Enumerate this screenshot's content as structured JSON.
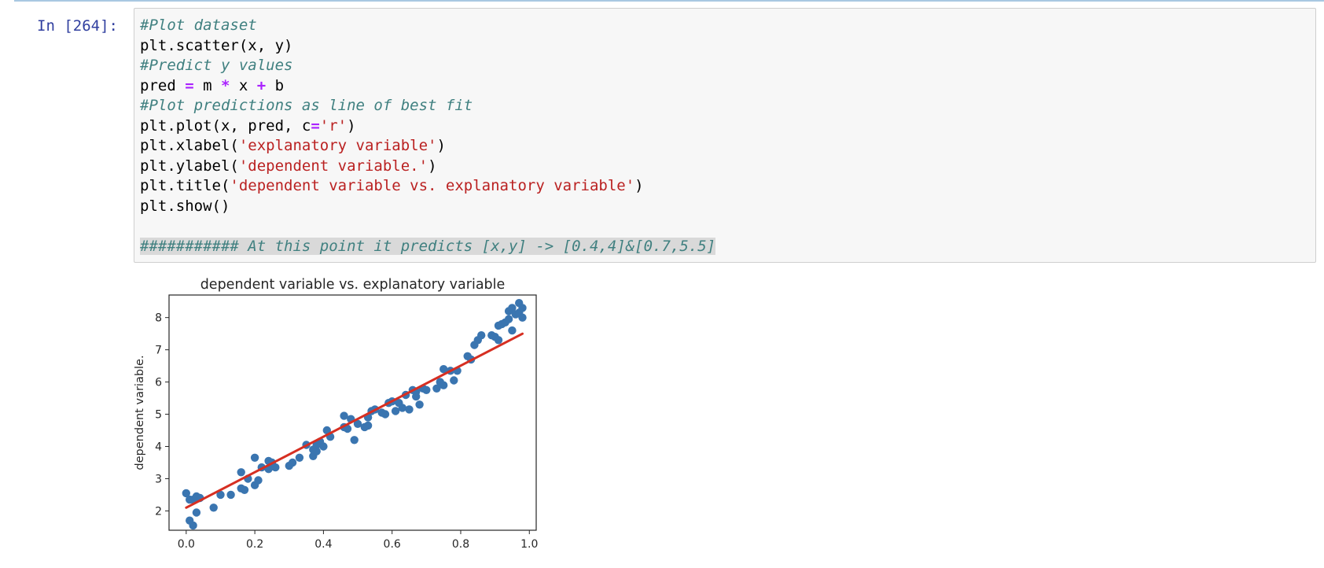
{
  "cell": {
    "prompt": "In [264]:",
    "code_lines": [
      [
        {
          "t": "#Plot dataset",
          "k": "comment"
        }
      ],
      [
        {
          "t": "plt.scatter(x, y)",
          "k": ""
        }
      ],
      [
        {
          "t": "#Predict y values",
          "k": "comment"
        }
      ],
      [
        {
          "t": "pred ",
          "k": ""
        },
        {
          "t": "=",
          "k": "op"
        },
        {
          "t": " m ",
          "k": ""
        },
        {
          "t": "*",
          "k": "op"
        },
        {
          "t": " x ",
          "k": ""
        },
        {
          "t": "+",
          "k": "op"
        },
        {
          "t": " b",
          "k": ""
        }
      ],
      [
        {
          "t": "#Plot predictions as line of best fit",
          "k": "comment"
        }
      ],
      [
        {
          "t": "plt.plot(x, pred, c",
          "k": ""
        },
        {
          "t": "=",
          "k": "op"
        },
        {
          "t": "'r'",
          "k": "str"
        },
        {
          "t": ")",
          "k": ""
        }
      ],
      [
        {
          "t": "plt.xlabel(",
          "k": ""
        },
        {
          "t": "'explanatory variable'",
          "k": "str"
        },
        {
          "t": ")",
          "k": ""
        }
      ],
      [
        {
          "t": "plt.ylabel(",
          "k": ""
        },
        {
          "t": "'dependent variable.'",
          "k": "str"
        },
        {
          "t": ")",
          "k": ""
        }
      ],
      [
        {
          "t": "plt.title(",
          "k": ""
        },
        {
          "t": "'dependent variable vs. explanatory variable'",
          "k": "str"
        },
        {
          "t": ")",
          "k": ""
        }
      ],
      [
        {
          "t": "plt.show()",
          "k": ""
        }
      ],
      [],
      [
        {
          "t": "########### At this point it predicts [x,y] -> [0.4,4]&[0.7,5.5]",
          "k": "comment hl"
        }
      ]
    ]
  },
  "colors": {
    "points": "#3a75b0",
    "line": "#d62f22",
    "prompt": "#303f9f",
    "comment": "#408080",
    "string": "#ba2121",
    "operator": "#aa22ff"
  },
  "chart_data": {
    "type": "scatter",
    "title": "dependent variable vs. explanatory variable",
    "xlabel": "",
    "ylabel": "dependent variable.",
    "xlim": [
      -0.05,
      1.02
    ],
    "ylim": [
      1.4,
      8.7
    ],
    "xticks": [
      0.0,
      0.2,
      0.4,
      0.6,
      0.8,
      1.0
    ],
    "xtick_labels": [
      "0.0",
      "0.2",
      "0.4",
      "0.6",
      "0.8",
      "1.0"
    ],
    "yticks": [
      2,
      3,
      4,
      5,
      6,
      7,
      8
    ],
    "ytick_labels": [
      "2",
      "3",
      "4",
      "5",
      "6",
      "7",
      "8"
    ],
    "grid": false,
    "series": [
      {
        "kind": "points",
        "x": [
          0.0,
          0.01,
          0.02,
          0.03,
          0.04,
          0.01,
          0.02,
          0.03,
          0.08,
          0.1,
          0.13,
          0.16,
          0.16,
          0.17,
          0.18,
          0.2,
          0.2,
          0.21,
          0.22,
          0.24,
          0.24,
          0.25,
          0.26,
          0.3,
          0.31,
          0.33,
          0.35,
          0.37,
          0.37,
          0.38,
          0.38,
          0.39,
          0.4,
          0.41,
          0.42,
          0.46,
          0.46,
          0.47,
          0.48,
          0.49,
          0.5,
          0.52,
          0.53,
          0.53,
          0.54,
          0.55,
          0.57,
          0.58,
          0.59,
          0.6,
          0.61,
          0.62,
          0.63,
          0.64,
          0.65,
          0.66,
          0.67,
          0.67,
          0.68,
          0.69,
          0.7,
          0.73,
          0.74,
          0.75,
          0.75,
          0.77,
          0.78,
          0.79,
          0.82,
          0.83,
          0.84,
          0.85,
          0.86,
          0.89,
          0.9,
          0.91,
          0.91,
          0.92,
          0.93,
          0.94,
          0.94,
          0.95,
          0.95,
          0.96,
          0.97,
          0.97,
          0.98,
          0.98
        ],
        "y": [
          2.55,
          1.7,
          2.35,
          1.95,
          2.4,
          2.35,
          1.55,
          2.45,
          2.1,
          2.5,
          2.5,
          3.2,
          2.7,
          2.65,
          3.0,
          2.8,
          3.65,
          2.95,
          3.35,
          3.3,
          3.55,
          3.5,
          3.35,
          3.4,
          3.5,
          3.65,
          4.05,
          3.7,
          3.9,
          3.85,
          4.05,
          4.15,
          4.0,
          4.5,
          4.3,
          4.6,
          4.95,
          4.55,
          4.85,
          4.2,
          4.7,
          4.6,
          4.65,
          4.9,
          5.1,
          5.15,
          5.05,
          5.0,
          5.35,
          5.4,
          5.1,
          5.35,
          5.2,
          5.6,
          5.15,
          5.75,
          5.55,
          5.7,
          5.3,
          5.8,
          5.75,
          5.8,
          6.0,
          6.4,
          5.9,
          6.35,
          6.05,
          6.35,
          6.8,
          6.7,
          7.15,
          7.3,
          7.45,
          7.45,
          7.4,
          7.3,
          7.75,
          7.8,
          7.85,
          7.95,
          8.2,
          8.3,
          7.6,
          8.1,
          8.45,
          8.15,
          8.0,
          8.3
        ]
      },
      {
        "kind": "line",
        "x": [
          0.0,
          0.98
        ],
        "y": [
          2.1,
          7.5
        ]
      }
    ]
  }
}
